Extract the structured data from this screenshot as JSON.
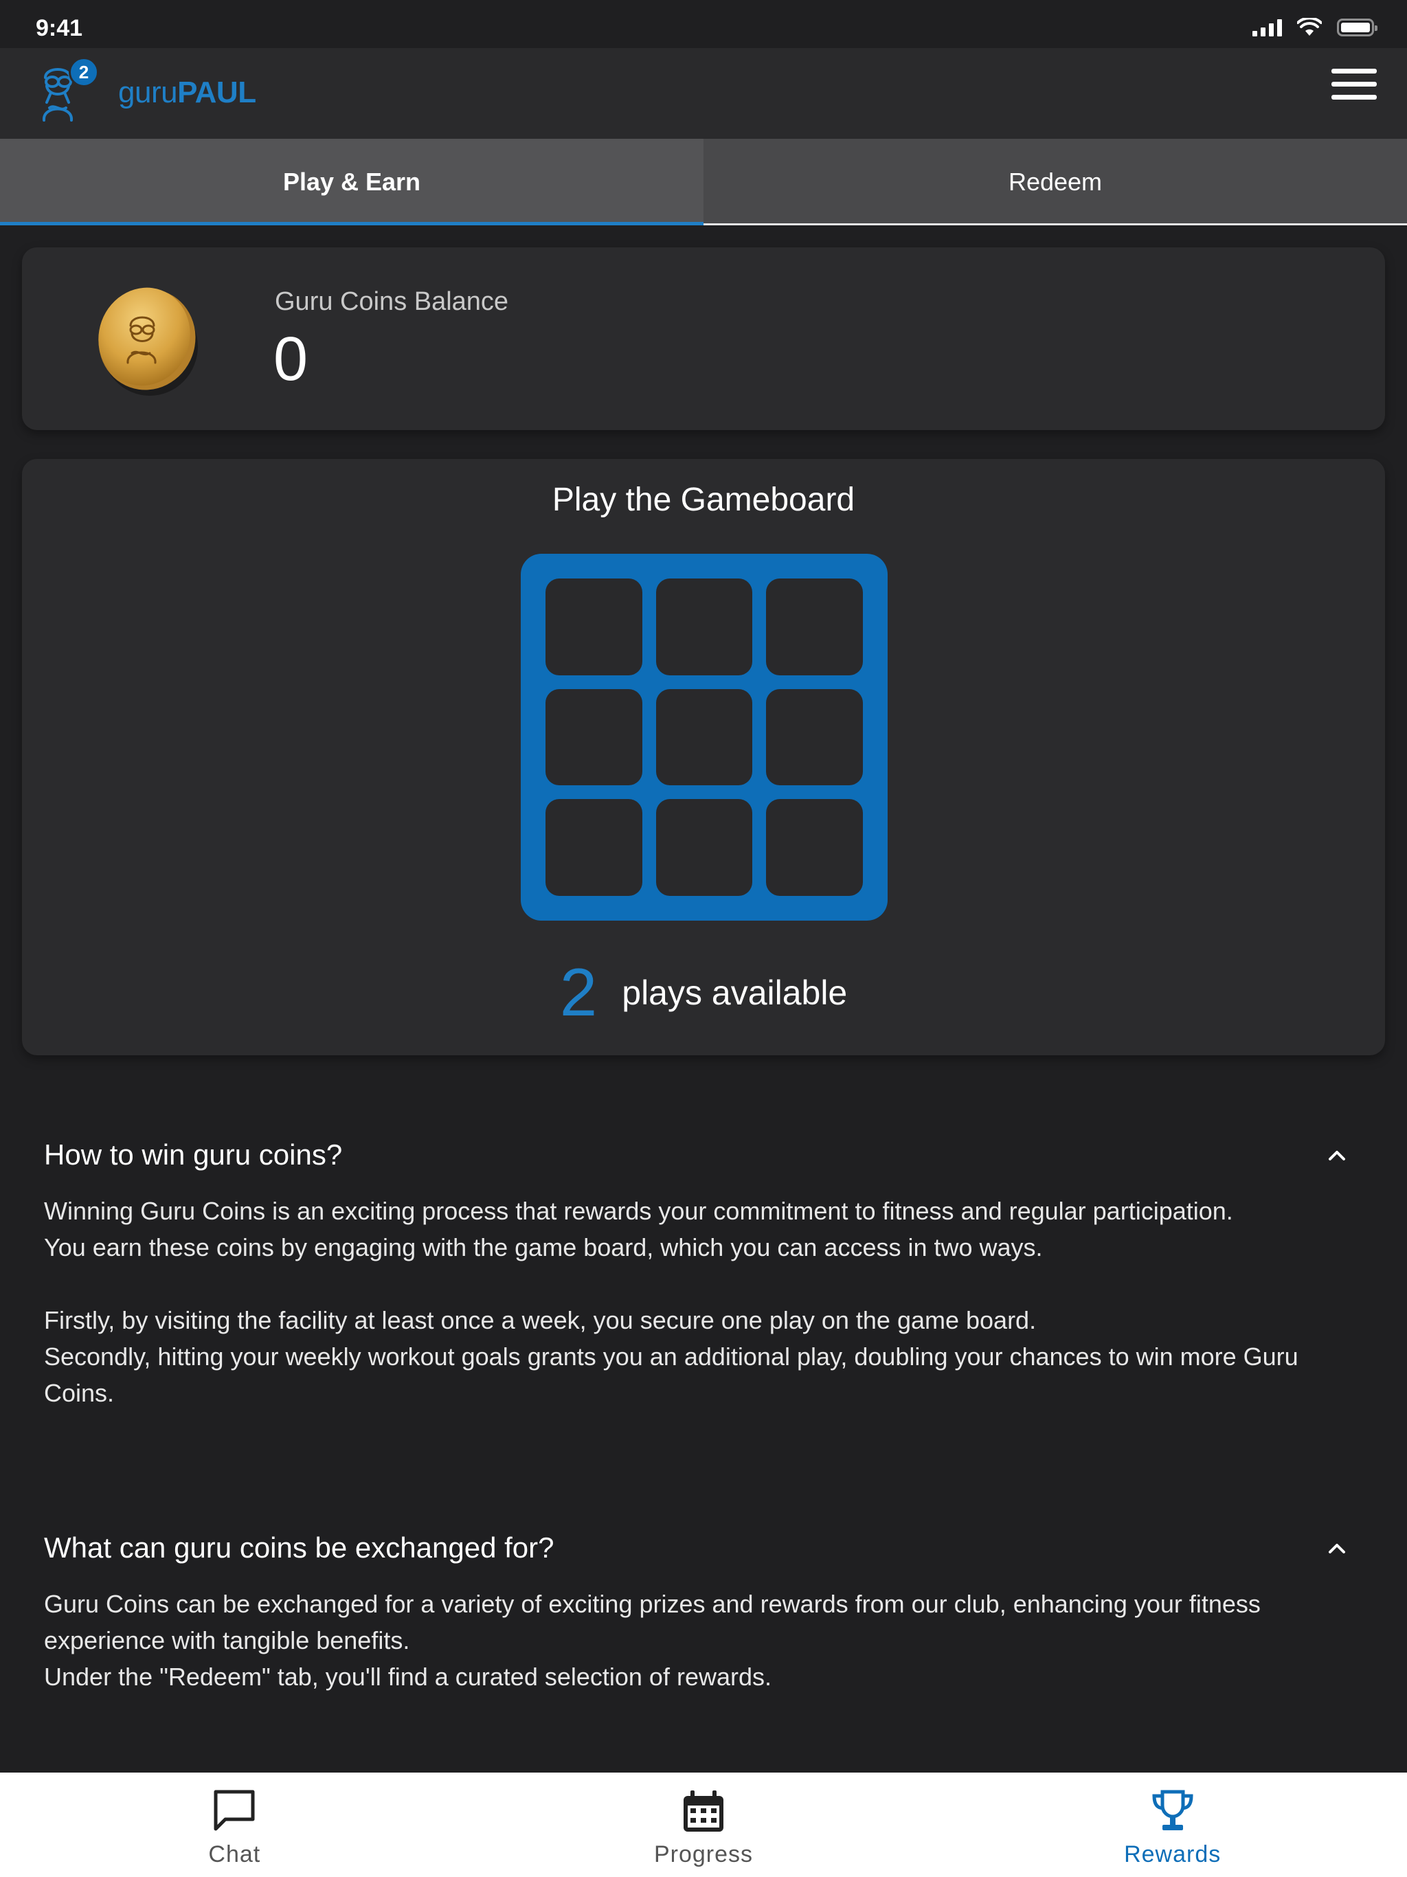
{
  "status_bar": {
    "time": "9:41"
  },
  "header": {
    "logo_text_light": "guru",
    "logo_text_bold": "PAUL",
    "notification_count": "2"
  },
  "tabs": [
    {
      "label": "Play & Earn",
      "active": true
    },
    {
      "label": "Redeem",
      "active": false
    }
  ],
  "balance": {
    "label": "Guru Coins Balance",
    "value": "0"
  },
  "gameboard": {
    "title": "Play the Gameboard",
    "plays_count": "2",
    "plays_label": "plays available"
  },
  "faq": [
    {
      "title": "How to win guru coins?",
      "expanded": true,
      "lines": [
        "Winning Guru Coins is an exciting process that rewards your commitment to fitness and regular participation.",
        "You earn these coins by engaging with the game board, which you can access in two ways.",
        "",
        "Firstly, by visiting the facility at least once a week, you secure one play on the game board.",
        "Secondly, hitting your weekly workout goals grants you an additional play, doubling your chances to win more Guru Coins."
      ]
    },
    {
      "title": "What can guru coins be exchanged for?",
      "expanded": true,
      "lines": [
        "Guru Coins can be exchanged for a variety of exciting prizes and rewards from our club, enhancing your fitness experience with tangible benefits.",
        "Under the \"Redeem\" tab, you'll find a curated selection of rewards."
      ]
    }
  ],
  "bottom_nav": [
    {
      "label": "Chat",
      "icon": "chat-bubble-icon",
      "active": false
    },
    {
      "label": "Progress",
      "icon": "calendar-icon",
      "active": false
    },
    {
      "label": "Rewards",
      "icon": "trophy-icon",
      "active": true
    }
  ],
  "colors": {
    "background": "#1f1f21",
    "card": "#2b2b2d",
    "accent": "#0e6eb8",
    "accent_text": "#1f7fc6",
    "coin": "#d9a441"
  }
}
